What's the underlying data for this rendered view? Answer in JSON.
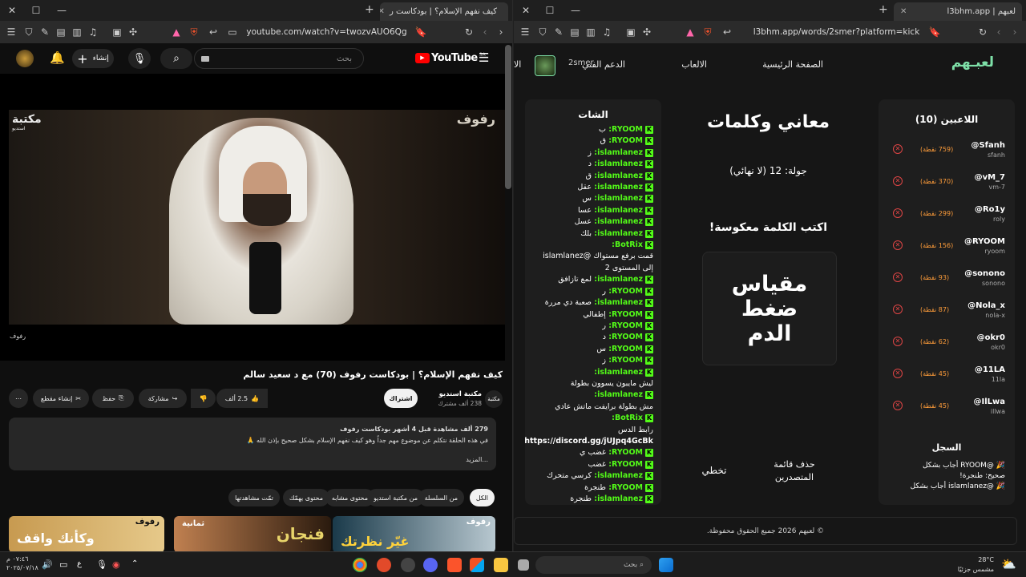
{
  "left_browser": {
    "tab_title": "كيف نفهم الإسلام؟ | بودكاست ر",
    "url": "youtube.com/watch?v=twozvAUO6Qg"
  },
  "youtube": {
    "logo": "YouTube",
    "logo_country": "SA",
    "search_placeholder": "بحث",
    "create_label": "إنشاء",
    "video_watermark": "رفوف",
    "video_channel_logo": "مكتبة",
    "video_channel_logo_sub": "استديو",
    "below_video_label": "رفوف",
    "title": "كيف نفهم الإسلام؟ | بودكاست رفوف (70) مع د سعيد سالم",
    "channel_name": "مكتبة استديو",
    "subscribers": "238 ألف مشترك",
    "subscribe_label": "اشتراك",
    "likes": "2.5 ألف",
    "share_label": "مشاركة",
    "save_label": "حفظ",
    "clip_label": "إنشاء مقطع",
    "desc_meta": "279 ألف مشاهدة  قبل 4 أشهر  بودكاست رفوف",
    "desc_text": "في هذه الحلقة نتكلم عن موضوع مهم جداً وهو كيف نفهم الإسلام بشكل صحيح بإذن الله 🙏",
    "more_label": "...المزيد",
    "filter_chips": [
      "الكل",
      "من السلسلة",
      "من مكتبة استديو",
      "محتوى مشابه",
      "محتوى يهمّك",
      "تمّت مشاهدتها"
    ],
    "thumbs": [
      {
        "t1": "رفوف",
        "t2": "غيّر نظرتك"
      },
      {
        "t1": "ثمانية",
        "t2": "فنجان"
      },
      {
        "t1": "رفوف",
        "t2": "وكأنك واقف"
      }
    ]
  },
  "right_browser": {
    "tab_title": "لعبهم | l3bhm.app",
    "url": "l3bhm.app/words/2smer?platform=kick"
  },
  "site": {
    "logo": "لعبـهم",
    "nav": [
      "الصفحة الرئيسية",
      "الالعاب",
      "الدعم الفني",
      "الا"
    ],
    "username": "2smer",
    "players_title": "اللاعبين (10)",
    "players": [
      {
        "name": "@Sfanh",
        "user": "sfanh",
        "points": "(759 نقطة)"
      },
      {
        "name": "@vM_7",
        "user": "vm-7",
        "points": "(370 نقطة)"
      },
      {
        "name": "@Ro1y",
        "user": "roly",
        "points": "(299 نقطة)"
      },
      {
        "name": "@RYOOM",
        "user": "ryoom",
        "points": "(156 نقطة)"
      },
      {
        "name": "@sonono",
        "user": "sonono",
        "points": "(93 نقطة)"
      },
      {
        "name": "@Nola_x",
        "user": "nola-x",
        "points": "(87 نقطة)"
      },
      {
        "name": "@okr0",
        "user": "okr0",
        "points": "(62 نقطة)"
      },
      {
        "name": "@11LA",
        "user": "11la",
        "points": "(45 نقطة)"
      },
      {
        "name": "@IlLwa",
        "user": "illwa",
        "points": "(45 نقطة)"
      }
    ],
    "log_title": "السجل",
    "log_lines": [
      "🎉 @RYOOM أجاب بشكل",
      "صحيح: طنجرة!",
      "🎉 @islamlanez أجاب بشكل"
    ],
    "game_title": "معاني وكلمات",
    "round": "جولة: 12 (لا نهائي)",
    "instruction": "اكتب الكلمة معكوسة!",
    "word_lines": [
      "مقياس",
      "ضغط",
      "الدم"
    ],
    "clear_label": "حذف قائمة\nالمتصدرين",
    "skip_label": "تخطي",
    "chat_title": "الشات",
    "chat": [
      {
        "u": "RYOOM:",
        "m": "ب"
      },
      {
        "u": "RYOOM:",
        "m": "ق"
      },
      {
        "u": "islamlanez:",
        "m": "ز"
      },
      {
        "u": "islamlanez:",
        "m": "د"
      },
      {
        "u": "islamlanez:",
        "m": "ق"
      },
      {
        "u": "islamlanez:",
        "m": "عقل"
      },
      {
        "u": "islamlanez:",
        "m": "س"
      },
      {
        "u": "islamlanez:",
        "m": "عسا"
      },
      {
        "u": "islamlanez:",
        "m": "عسل"
      },
      {
        "u": "islamlanez:",
        "m": "بلك"
      },
      {
        "u": "BotRix:",
        "m": ""
      },
      {
        "u": "",
        "m": "قمت برفع مستواك @islamlanez"
      },
      {
        "u": "",
        "m": "إلى المستوى 2"
      },
      {
        "u": "islamlanez:",
        "m": "لمع تازافق"
      },
      {
        "u": "RYOOM:",
        "m": "ر"
      },
      {
        "u": "islamlanez:",
        "m": "صعبة دي مررة"
      },
      {
        "u": "RYOOM:",
        "m": "إطفالي"
      },
      {
        "u": "RYOOM:",
        "m": "ر"
      },
      {
        "u": "RYOOM:",
        "m": "د"
      },
      {
        "u": "RYOOM:",
        "m": "س"
      },
      {
        "u": "RYOOM:",
        "m": "ز"
      },
      {
        "u": "islamlanez:",
        "m": ""
      },
      {
        "u": "",
        "m": "ليش مايبون يسوون بطولة"
      },
      {
        "u": "islamlanez:",
        "m": ""
      },
      {
        "u": "",
        "m": "مش بطولة برايفت ماتش عادي"
      },
      {
        "u": "BotRix:",
        "m": ""
      },
      {
        "u": "",
        "m": "رابط الدس"
      },
      {
        "u": "",
        "m": "https://discord.gg/jUJpq4GcBk"
      },
      {
        "u": "RYOOM:",
        "m": "غضب ي"
      },
      {
        "u": "RYOOM:",
        "m": "غضب"
      },
      {
        "u": "islamlanez:",
        "m": "كرسي متحرك"
      },
      {
        "u": "RYOOM:",
        "m": "طنجرة"
      },
      {
        "u": "islamlanez:",
        "m": "طنجرة"
      }
    ],
    "footer": "© لعبهم 2026 جميع الحقوق محفوظة."
  },
  "taskbar": {
    "search_placeholder": "بحث",
    "weather_temp": "28°C",
    "weather_desc": "مشمس جزئيًا",
    "time": "٠٧:٤٦ م",
    "date": "٢٠٢٥/٠٧/١٨",
    "lang": "ع"
  }
}
